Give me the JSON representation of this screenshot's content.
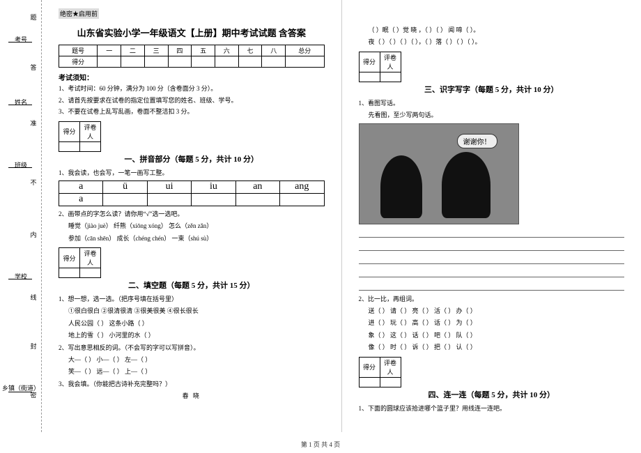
{
  "binding": {
    "labels": [
      "考号",
      "姓名",
      "班级",
      "学校",
      "乡镇（街道）"
    ],
    "marks": [
      "题",
      "答",
      "准",
      "不",
      "内",
      "线",
      "封",
      "密"
    ]
  },
  "secret": "绝密★启用前",
  "title": "山东省实验小学一年级语文【上册】期中考试试题 含答案",
  "score_table": {
    "header": [
      "题号",
      "一",
      "二",
      "三",
      "四",
      "五",
      "六",
      "七",
      "八",
      "总分"
    ],
    "row_label": "得分"
  },
  "notice_head": "考试须知：",
  "notices": [
    "1、考试时间：60 分钟，满分为 100 分（含卷面分 3 分）。",
    "2、请首先按要求在试卷的指定位置填写您的姓名、班级、学号。",
    "3、不要在试卷上乱写乱画，卷面不整洁扣 3 分。"
  ],
  "scorebox": {
    "c1": "得分",
    "c2": "评卷人"
  },
  "sections": {
    "s1": "一、拼音部分（每题 5 分，共计 10 分）",
    "s2": "二、填空题（每题 5 分，共计 15 分）",
    "s3": "三、识字写字（每题 5 分，共计 10 分）",
    "s4": "四、连一连（每题 5 分，共计 10 分）"
  },
  "q1": {
    "t1": "1、我会读，也会写，一笔一画写工整。",
    "pinyin": [
      "a",
      "ü",
      "ui",
      "iu",
      "an",
      "ang"
    ],
    "t2": "2、画带点的字怎么读？请你用“√”选一选吧。",
    "items": [
      "睡觉（jiào  juè）        纤熊（xiōng  xóng）        怎么（zěn  zǎn）",
      "参加（cān  shēn）      成长（chéng  chén）        一束（shú  sù）"
    ]
  },
  "q2": {
    "t1": "1、想一想，选一选。（把序号填在括号里）",
    "opts": "①很白很白   ②很清很清   ③很美很美   ④很长很长",
    "lines": [
      "人民公园（     ）             这条小路（     ）",
      "地上的雪（     ）             小河里的水（     ）"
    ],
    "t2": "2、写出意思相反的词。（不会写的字可以写拼音）。",
    "pairs": [
      "大—（     ）      小—（     ）      左—（     ）",
      "笑—（     ）      远—（     ）      上—（     ）"
    ],
    "t3": "3、我会填。（你能把古诗补充完整吗？）",
    "poem_title": "春   晓"
  },
  "right_top": {
    "l1": "（   ）眠（   ）觉 晓 ，（   ）（   ） 闻 啼（   ）。",
    "l2": "夜（   ）（   ）（   ）（   ），（   ）落（   ）（   ）（   ）。"
  },
  "q3": {
    "t1": "1、看图写话。",
    "t2": "先看图，至少写两句话。",
    "bubble": "谢谢你！",
    "t3": "2、比一比，再组词。",
    "rows": [
      "送（     ）   请（     ）   亮（     ）   活（     ）   办（     ）",
      "进（     ）   玩（     ）   高（     ）   话（     ）   为（     ）",
      "象（     ）   这（     ）   话（     ）   吧（     ）   队（     ）",
      "像（     ）   时（     ）   诉（     ）   把（     ）   认（     ）"
    ]
  },
  "q4": {
    "t1": "1、下面的圆球应该拾进哪个篮子里？用线连一连吧。"
  },
  "footer": "第 1 页 共 4 页"
}
